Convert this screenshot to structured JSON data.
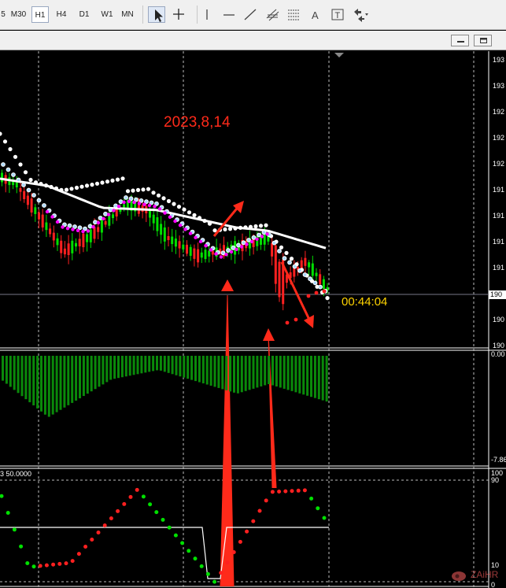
{
  "toolbar": {
    "timeframes": [
      {
        "label": "5",
        "active": false
      },
      {
        "label": "M30",
        "active": false
      },
      {
        "label": "H1",
        "active": true
      },
      {
        "label": "H4",
        "active": false
      },
      {
        "label": "D1",
        "active": false
      },
      {
        "label": "W1",
        "active": false
      },
      {
        "label": "MN",
        "active": false
      }
    ],
    "tools": [
      {
        "icon": "cursor-icon",
        "active": true
      },
      {
        "icon": "crosshair-icon",
        "active": false
      },
      {
        "icon": "vertical-line-icon",
        "active": false
      },
      {
        "icon": "horizontal-line-icon",
        "active": false
      },
      {
        "icon": "trendline-icon",
        "active": false
      },
      {
        "icon": "equidistant-channel-icon",
        "active": false
      },
      {
        "icon": "fibonacci-icon",
        "active": false
      },
      {
        "icon": "text-icon",
        "active": false
      },
      {
        "icon": "text-label-icon",
        "active": false
      },
      {
        "icon": "arrows-dropdown-icon",
        "active": false
      }
    ]
  },
  "window_controls": [
    "minimize-icon",
    "restore-icon"
  ],
  "price_axis": {
    "labels": [
      "193",
      "193",
      "192",
      "192",
      "192",
      "191",
      "191",
      "191",
      "191",
      "190",
      "190",
      "190"
    ],
    "current_bid": "190"
  },
  "countdown": "00:44:04",
  "annotation": "2023,8,14",
  "histogram_axis": {
    "top": "0.00",
    "bottom": "-7.86"
  },
  "oscillator": {
    "title_fragment": "3 50.0000",
    "axis_labels": [
      "100",
      "90",
      "10",
      "0"
    ]
  },
  "watermark": {
    "text": "ZAiHR"
  },
  "colors": {
    "background": "#000000",
    "bull_candle": "#00e000",
    "bear_candle": "#ff2020",
    "moving_average": "#ffffff",
    "dots_white": "#ffffff",
    "dots_magenta": "#ff00ff",
    "dots_lightblue": "#aad8ff",
    "histogram": "#0a8a0a",
    "oscillator_up": "#00e000",
    "oscillator_down": "#ff2020",
    "annotation_red": "#ff2a1a",
    "timer_yellow": "#ffd400"
  }
}
